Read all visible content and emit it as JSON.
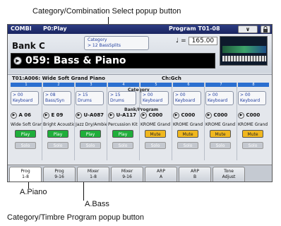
{
  "callouts": {
    "top": "Category/Combination Select popup button",
    "piano": "A.Piano",
    "bass": "A.Bass",
    "bottom": "Category/Timbre Program popup button"
  },
  "topbar": {
    "mode": "COMBI",
    "page": "P0:Play",
    "program": "Program T01-08",
    "menu_glyph": "∨"
  },
  "bank": {
    "label": "Bank C",
    "category_line1": "Category",
    "category_line2": "> 12 BassSplits",
    "tempo_symbol": "♩ =",
    "tempo_value": "165.00",
    "combi_name": "059: Bass & Piano"
  },
  "timbre_header": {
    "program": "T01:A006: Wide Soft Grand Piano",
    "channel": "Ch:Gch"
  },
  "section_labels": {
    "category": "Category",
    "bank_program": "Bank/Program"
  },
  "columns": [
    {
      "num": "1",
      "cat_num": "> 00",
      "cat_name": "Keyboard",
      "prog": "A 06",
      "pname": "Wide Soft Grand",
      "state": "Play",
      "solo": "Solo"
    },
    {
      "num": "2",
      "cat_num": "> 08",
      "cat_name": "Bass/Syn",
      "prog": "E 09",
      "pname": "Bright Acoustic",
      "state": "Play",
      "solo": "Solo"
    },
    {
      "num": "3",
      "cat_num": "> 15",
      "cat_name": "Drums",
      "prog": "U-A087",
      "pname": "Jazz Dry/Ambient",
      "state": "Play",
      "solo": "Solo"
    },
    {
      "num": "4",
      "cat_num": "> 15",
      "cat_name": "Drums",
      "prog": "U-A117",
      "pname": "Percussion Kit",
      "state": "Play",
      "solo": "Solo"
    },
    {
      "num": "5",
      "cat_num": "> 00",
      "cat_name": "Keyboard",
      "prog": "C000",
      "pname": "KROME Grand",
      "state": "Mute",
      "solo": "Solo"
    },
    {
      "num": "6",
      "cat_num": "> 00",
      "cat_name": "Keyboard",
      "prog": "C000",
      "pname": "KROME Grand",
      "state": "Mute",
      "solo": "Solo"
    },
    {
      "num": "7",
      "cat_num": "> 00",
      "cat_name": "Keyboard",
      "prog": "C000",
      "pname": "KROME Grand",
      "state": "Mute",
      "solo": "Solo"
    },
    {
      "num": "8",
      "cat_num": "> 00",
      "cat_name": "Keyboard",
      "prog": "C000",
      "pname": "KROME Grand",
      "state": "Mute",
      "solo": "Solo"
    }
  ],
  "tabs": [
    {
      "l1": "Prog",
      "l2": "1-8"
    },
    {
      "l1": "Prog",
      "l2": "9-16"
    },
    {
      "l1": "Mixer",
      "l2": "1-8"
    },
    {
      "l1": "Mixer",
      "l2": "9-16"
    },
    {
      "l1": "ARP",
      "l2": "A"
    },
    {
      "l1": "ARP",
      "l2": "B"
    },
    {
      "l1": "Tone",
      "l2": "Adjust"
    }
  ],
  "colors": {
    "title_bar": "#1a2560",
    "play": "#1fae3a",
    "mute": "#f0b71e",
    "column_number": "#2b6fd0"
  }
}
